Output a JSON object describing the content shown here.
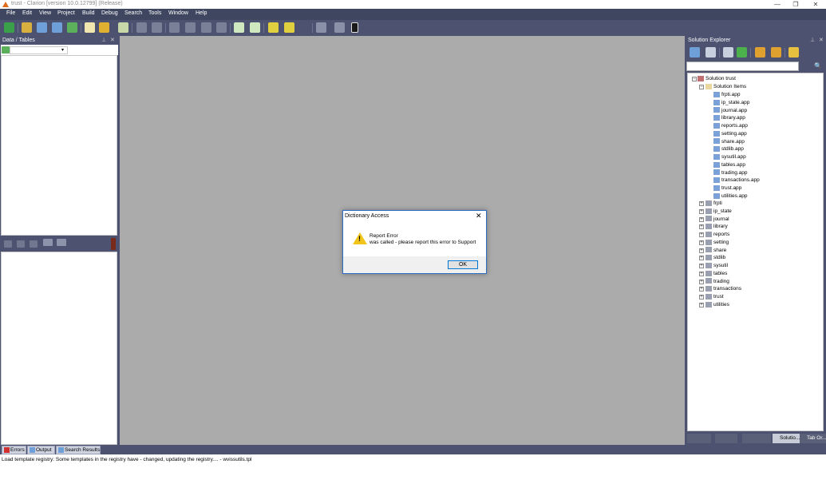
{
  "window": {
    "title": "trust - Clarion [version 10.0.12799] (Release)",
    "controls": [
      "—",
      "❐",
      "✕"
    ]
  },
  "menu": [
    "File",
    "Edit",
    "View",
    "Project",
    "Build",
    "Debug",
    "Search",
    "Tools",
    "Window",
    "Help"
  ],
  "left_panel": {
    "title": "Data / Tables",
    "pin": "⊥",
    "close": "✕"
  },
  "dialog": {
    "title": "Dictionary Access",
    "close": "✕",
    "message_line1": "Report Error",
    "message_line2": "was called - please report this error to Support",
    "ok_label": "OK",
    "icon": "warning-icon"
  },
  "solution_explorer": {
    "title": "Solution Explorer",
    "pin": "⊥",
    "close": "✕",
    "search_icon": "🔍",
    "root": "Solution trust",
    "solution_items_label": "Solution Items",
    "solution_items": [
      "frpti.app",
      "ip_state.app",
      "journal.app",
      "library.app",
      "reports.app",
      "setting.app",
      "share.app",
      "stdlib.app",
      "sysutil.app",
      "tables.app",
      "trading.app",
      "transactions.app",
      "trust.app",
      "utilities.app"
    ],
    "projects": [
      "frpti",
      "ip_state",
      "journal",
      "library",
      "reports",
      "setting",
      "share",
      "stdlib",
      "sysutil",
      "tables",
      "trading",
      "transactions",
      "trust",
      "utilities"
    ],
    "tabs": [
      "Solutio...",
      "Tab Or..."
    ]
  },
  "bottom_tabs": [
    "Errors",
    "Output",
    "Search Results"
  ],
  "status": "Load template registry: Some templates in the registry have - changed, updating the registry.... - wvissutils.tpl",
  "colors": {
    "chrome": "#4c5270",
    "menubar": "#3e4660",
    "workarea": "#ababab",
    "warning": "#f0c419",
    "dialog_border": "#2a6fc4"
  }
}
